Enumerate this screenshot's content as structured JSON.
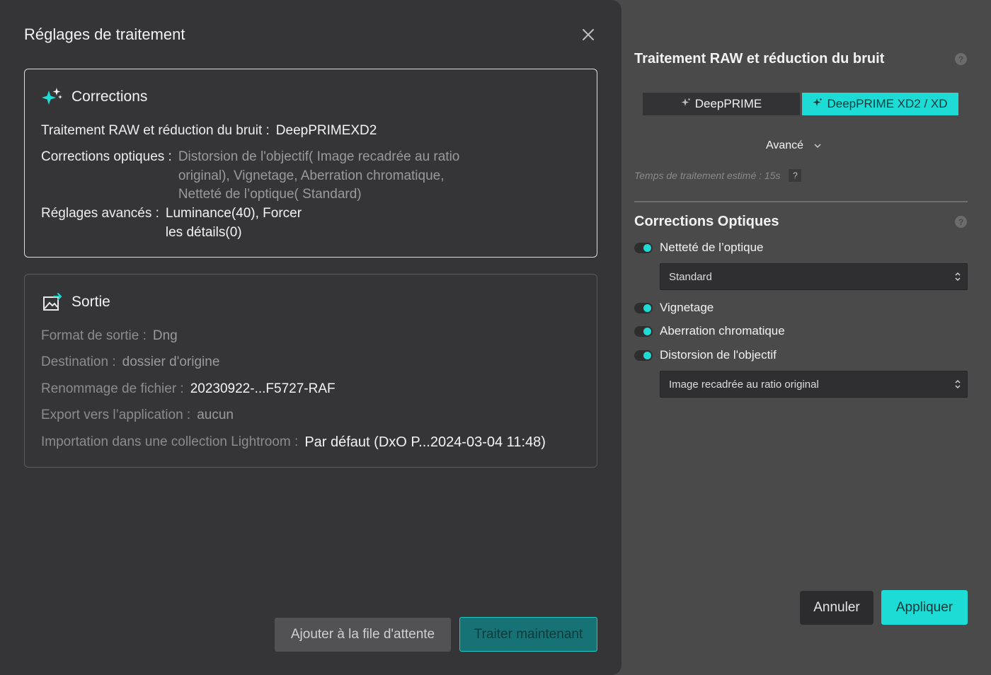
{
  "dialog": {
    "title": "Réglages de traitement",
    "corrections": {
      "title": "Corrections",
      "raw_label": "Traitement RAW et réduction du bruit :",
      "raw_value": "DeepPRIMEXD2",
      "optical_label": "Corrections optiques :",
      "optical_lines": [
        "Distorsion de l'objectif( Image recadrée au ratio",
        "original), Vignetage, Aberration chromatique,",
        "Netteté de l’optique( Standard)"
      ],
      "advanced_label": "Réglages avancés :",
      "advanced_lines": [
        "Luminance(40), Forcer",
        "les détails(0)"
      ]
    },
    "output": {
      "title": "Sortie",
      "rows": [
        {
          "label": "Format de sortie :",
          "value": "Dng"
        },
        {
          "label": "Destination :",
          "value": "dossier d'origine"
        },
        {
          "label": "Renommage de fichier :",
          "value": "20230922-...F5727-RAF"
        },
        {
          "label": "Export vers l’application :",
          "value": "aucun"
        },
        {
          "label": "Importation dans une collection Lightroom :",
          "value": "Par défaut (DxO P...2024-03-04 11:48)"
        }
      ]
    },
    "queue_button": "Ajouter à la file d'attente",
    "process_button": "Traiter maintenant"
  },
  "panel": {
    "raw_title": "Traitement RAW et réduction du bruit",
    "help_glyph": "?",
    "mode_a": "DeepPRIME",
    "mode_b": "DeepPRIME XD2 / XD",
    "advanced": "Avancé",
    "estimate": "Temps de traitement estimé : 15s",
    "estimate_help": "?",
    "optical_title": "Corrections Optiques",
    "toggles": {
      "sharpness": "Netteté de l’optique",
      "vignetting": "Vignetage",
      "chromatic": "Aberration chromatique",
      "distortion": "Distorsion de l'objectif"
    },
    "sharpness_select": "Standard",
    "distortion_select": "Image recadrée au ratio original",
    "cancel": "Annuler",
    "apply": "Appliquer"
  },
  "colors": {
    "accent": "#1ddcd6",
    "dialog_bg": "#353537",
    "panel_bg": "#4a4a4a"
  },
  "icons": {
    "close": "close-icon",
    "sparkle": "sparkle-icon",
    "export": "image-export-icon",
    "help": "help-icon",
    "chevron": "chevron-down-icon",
    "select": "select-arrows-icon"
  }
}
